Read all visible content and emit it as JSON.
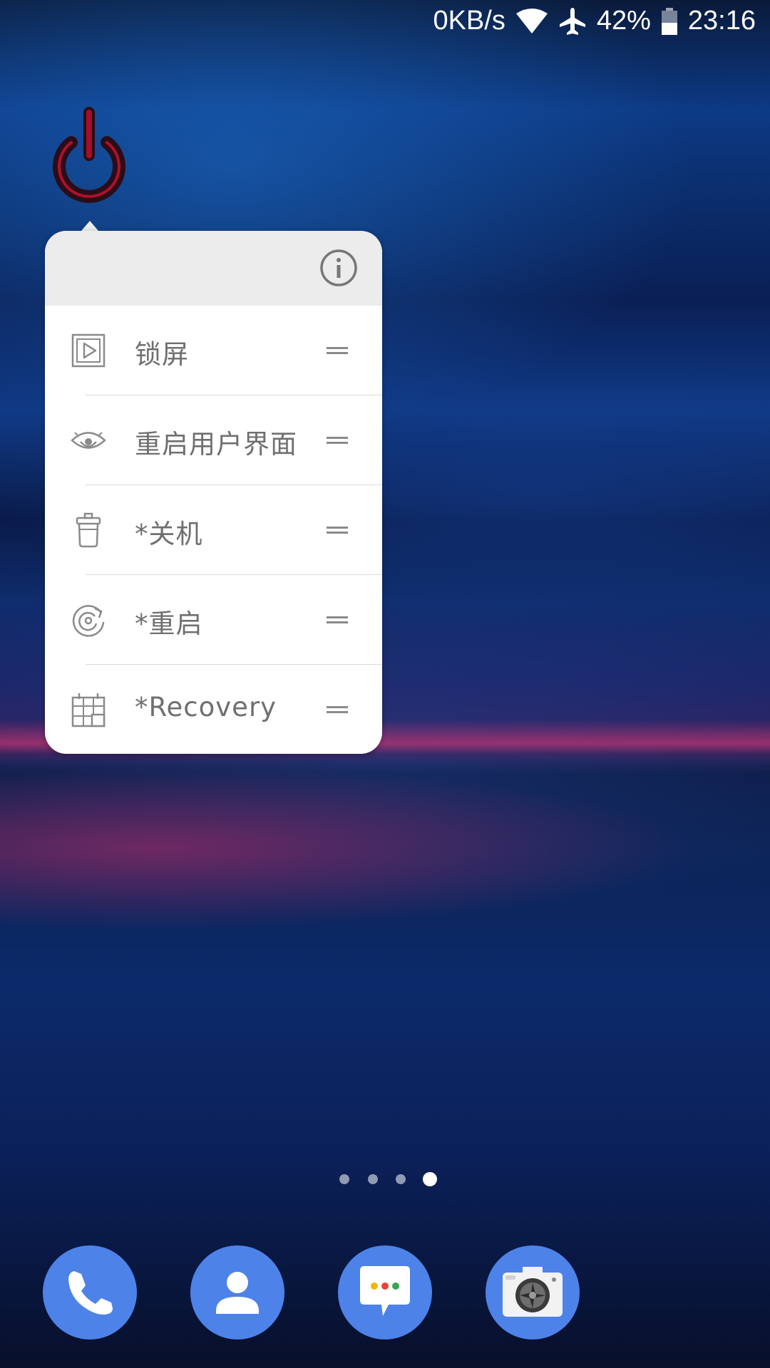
{
  "status_bar": {
    "net_speed": "0KB/s",
    "battery": "42%",
    "time": "23:16",
    "icons": [
      "wifi-icon",
      "airplane-icon",
      "battery-icon"
    ]
  },
  "power_widget": {
    "icon": "power-icon",
    "color": "#b0102a"
  },
  "popup": {
    "header_icon": "info-icon",
    "items": [
      {
        "label": "锁屏",
        "icon": "play-box-icon"
      },
      {
        "label": "重启用户界面",
        "icon": "eye-icon"
      },
      {
        "label": "*关机",
        "icon": "trash-icon"
      },
      {
        "label": "*重启",
        "icon": "restart-icon"
      },
      {
        "label": "*Recovery",
        "icon": "grid-calendar-icon"
      }
    ],
    "handle_icon": "drag-handle-icon"
  },
  "page_indicator": {
    "count": 4,
    "active_index": 3
  },
  "dock": {
    "apps": [
      {
        "name": "phone",
        "icon": "phone-icon"
      },
      {
        "name": "contacts",
        "icon": "contacts-icon"
      },
      {
        "name": "messages",
        "icon": "messages-icon"
      },
      {
        "name": "camera",
        "icon": "camera-icon"
      }
    ],
    "accent": "#4d82e8"
  }
}
